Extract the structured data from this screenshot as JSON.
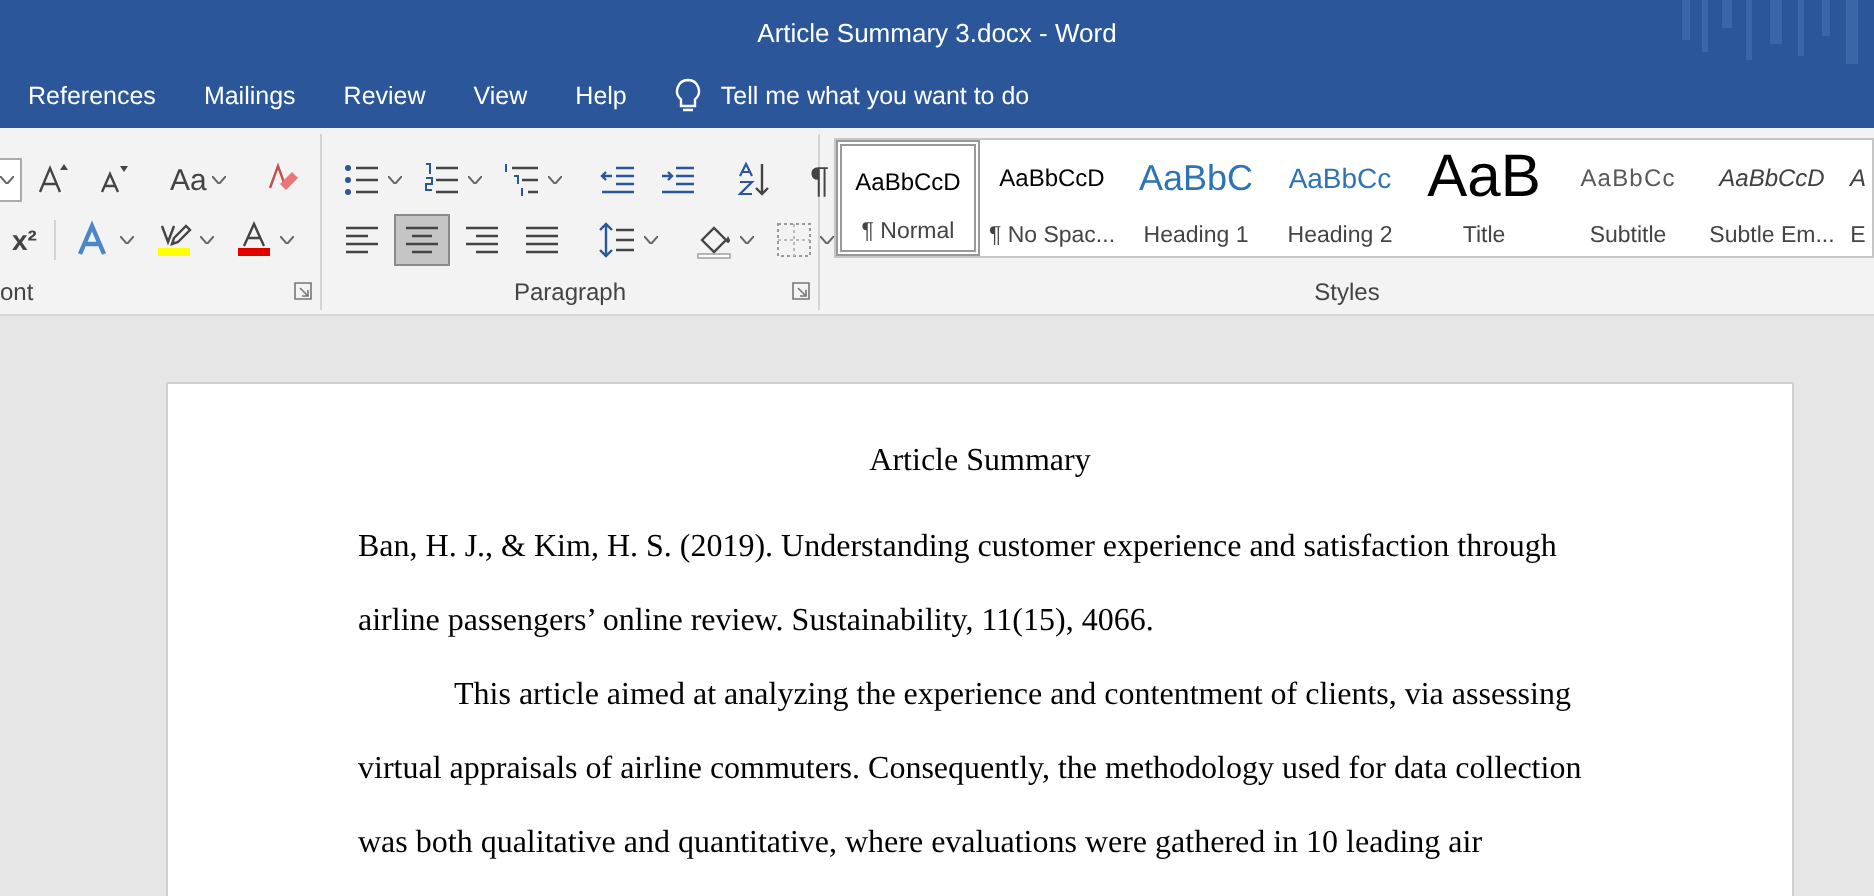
{
  "window": {
    "title": "Article Summary 3.docx - Word"
  },
  "tabs": [
    {
      "label": "References",
      "selected": false
    },
    {
      "label": "Mailings",
      "selected": false
    },
    {
      "label": "Review",
      "selected": false
    },
    {
      "label": "View",
      "selected": false
    },
    {
      "label": "Help",
      "selected": false
    }
  ],
  "tell_me": {
    "placeholder": "Tell me what you want to do"
  },
  "ribbon": {
    "font": {
      "label": "ont",
      "row1": [
        {
          "kind": "grow-font"
        },
        {
          "kind": "shrink-font"
        },
        {
          "kind": "sep"
        },
        {
          "kind": "change-case",
          "text": "Aa",
          "dropdown": true
        },
        {
          "kind": "sep"
        },
        {
          "kind": "clear-formatting"
        }
      ],
      "row2": [
        {
          "kind": "superscript",
          "text": "x²"
        },
        {
          "kind": "sep"
        },
        {
          "kind": "text-effects",
          "dropdown": true
        },
        {
          "kind": "highlight",
          "dropdown": true
        },
        {
          "kind": "font-color",
          "dropdown": true
        }
      ]
    },
    "paragraph": {
      "label": "Paragraph",
      "row1": [
        {
          "kind": "bullets",
          "dropdown": true
        },
        {
          "kind": "numbering",
          "dropdown": true
        },
        {
          "kind": "multilevel",
          "dropdown": true
        },
        {
          "kind": "sep"
        },
        {
          "kind": "decrease-indent"
        },
        {
          "kind": "increase-indent"
        },
        {
          "kind": "sep"
        },
        {
          "kind": "sort"
        },
        {
          "kind": "sep"
        },
        {
          "kind": "show-marks",
          "text": "¶"
        }
      ],
      "alignment": [
        {
          "kind": "align-left",
          "selected": false
        },
        {
          "kind": "align-center",
          "selected": true
        },
        {
          "kind": "align-right",
          "selected": false
        },
        {
          "kind": "justify",
          "selected": false
        }
      ],
      "row2": [
        {
          "kind": "sep"
        },
        {
          "kind": "line-spacing",
          "dropdown": true
        },
        {
          "kind": "sep"
        },
        {
          "kind": "shading",
          "dropdown": true
        },
        {
          "kind": "borders",
          "dropdown": true
        }
      ]
    },
    "styles": {
      "label": "Styles",
      "items": [
        {
          "kind": "normal",
          "preview": "AaBbCcD",
          "name": "¶ Normal",
          "selected": true
        },
        {
          "kind": "normal",
          "preview": "AaBbCcD",
          "name": "¶ No Spac...",
          "selected": false
        },
        {
          "kind": "heading1",
          "preview": "AaBbC",
          "name": "Heading 1",
          "selected": false
        },
        {
          "kind": "heading2",
          "preview": "AaBbCc",
          "name": "Heading 2",
          "selected": false
        },
        {
          "kind": "title",
          "preview": "AaB",
          "name": "Title",
          "selected": false
        },
        {
          "kind": "subtitle",
          "preview": "AaBbCc",
          "name": "Subtitle",
          "selected": false
        },
        {
          "kind": "emphasis",
          "preview": "AaBbCcD",
          "name": "Subtle Em...",
          "selected": false
        },
        {
          "kind": "emphasis",
          "preview": "A",
          "name": "E",
          "selected": false
        }
      ]
    }
  },
  "document": {
    "title": "Article Summary",
    "paragraphs": [
      {
        "kind": "reference",
        "text": "Ban, H. J., & Kim, H. S. (2019). Understanding customer experience and satisfaction through airline passengers’ online review. Sustainability, 11(15), 4066."
      },
      {
        "kind": "body",
        "text": "This article aimed at analyzing the experience and contentment of clients, via assessing virtual appraisals of airline commuters. Consequently, the methodology used for data collection was both qualitative and quantitative, where evaluations were gathered in 10 leading air"
      }
    ]
  }
}
